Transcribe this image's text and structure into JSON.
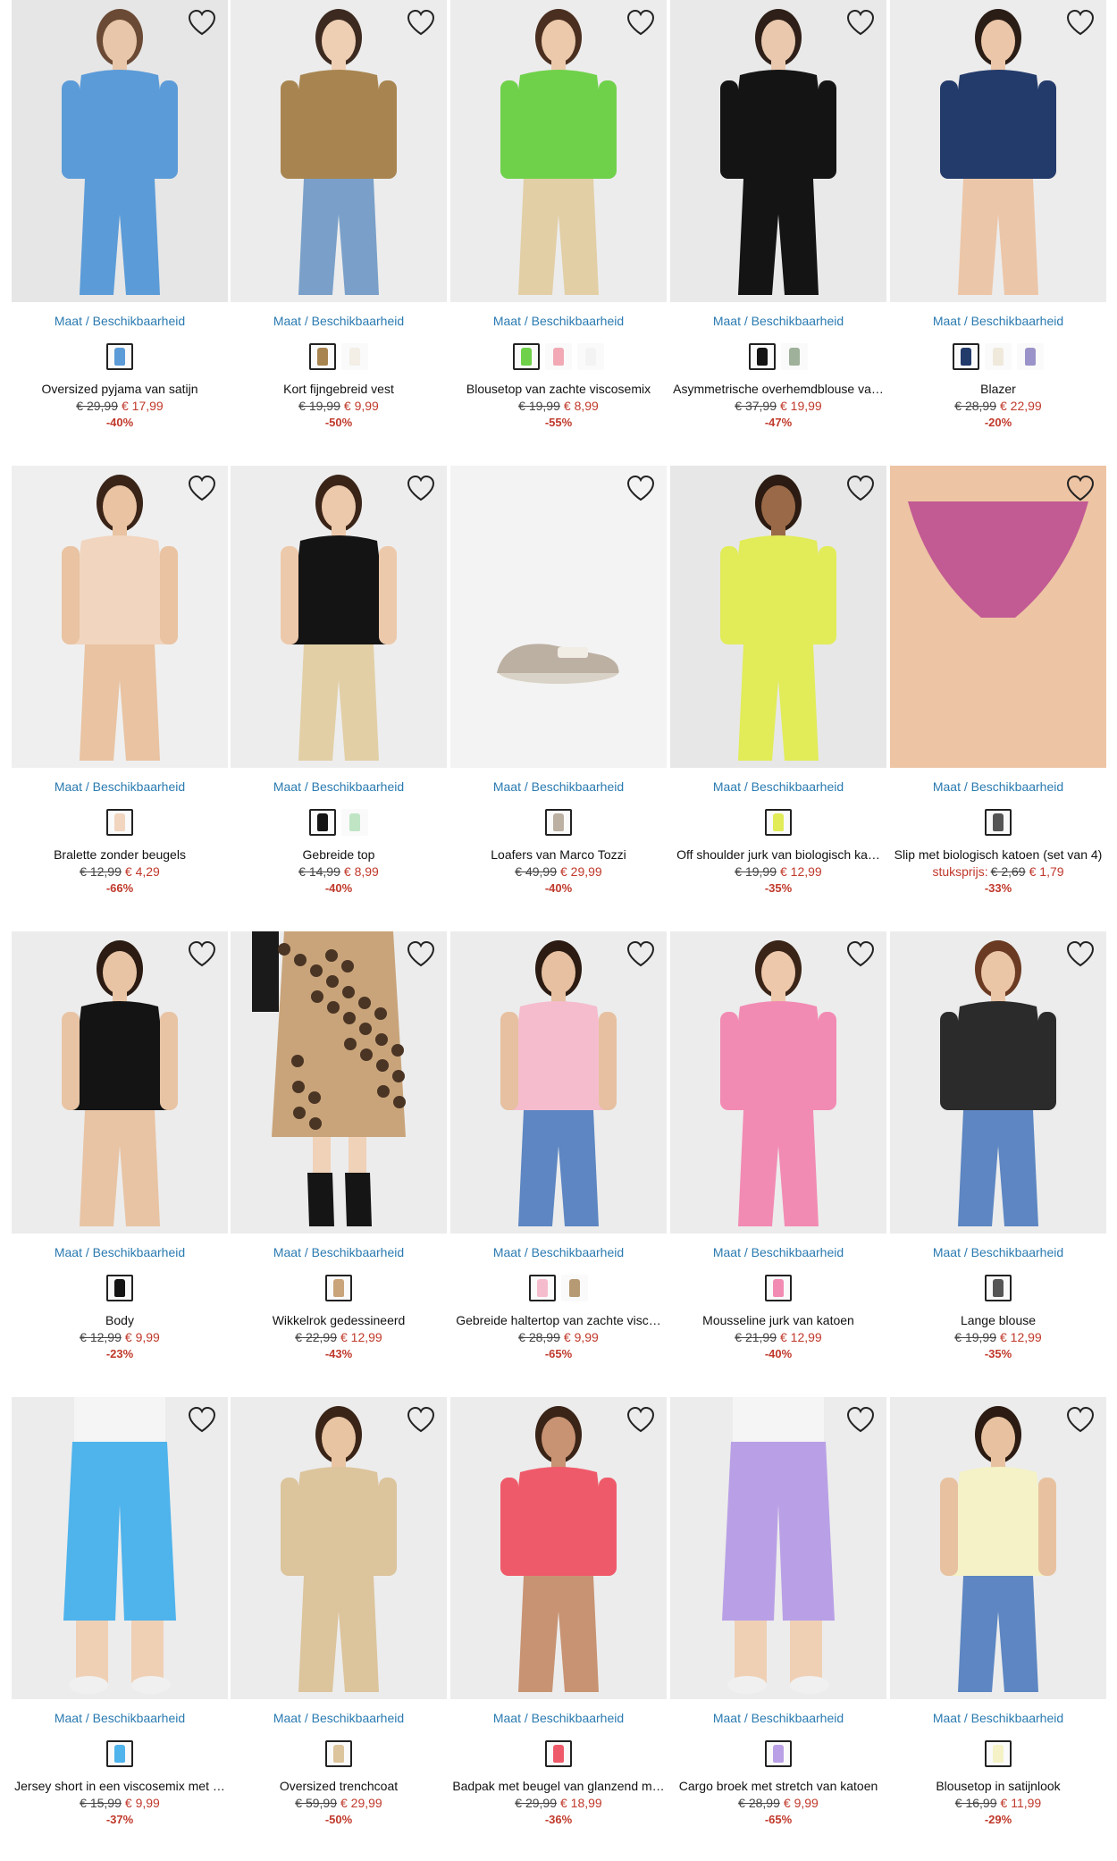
{
  "labels": {
    "maat": "Maat / Beschikbaarheid"
  },
  "products": [
    {
      "name": "Oversized pyjama van satijn",
      "old": "€ 29,99",
      "new": "€ 17,99",
      "disc": "-40%",
      "bg": "#e6e6e6",
      "garment": "#5b9bd8",
      "skin": "#e8c6a9",
      "hair": "#6b4a35",
      "swatches": [
        "#5b9bd8"
      ]
    },
    {
      "name": "Kort fijngebreid vest",
      "old": "€ 19,99",
      "new": "€ 9,99",
      "disc": "-50%",
      "bg": "#ececec",
      "garment": "#a88550",
      "skin": "#efcfb4",
      "hair": "#3c2a20",
      "swatches": [
        "#a88550",
        "#f3eee6"
      ]
    },
    {
      "name": "Blousetop van zachte viscosemix",
      "old": "€ 19,99",
      "new": "€ 8,99",
      "disc": "-55%",
      "bg": "#ececec",
      "garment": "#6fd14a",
      "skin": "#ecc9ab",
      "hair": "#4a2f20",
      "swatches": [
        "#6fd14a",
        "#f2a9b5",
        "#f3f3f3"
      ]
    },
    {
      "name": "Asymmetrische overhemdblouse va…",
      "old": "€ 37,99",
      "new": "€ 19,99",
      "disc": "-47%",
      "bg": "#e9e9e9",
      "garment": "#141414",
      "skin": "#eac8ad",
      "hair": "#2e2018",
      "swatches": [
        "#141414",
        "#9fb19a"
      ]
    },
    {
      "name": "Blazer",
      "old": "€ 28,99",
      "new": "€ 22,99",
      "disc": "-20%",
      "bg": "#ececec",
      "garment": "#233b6b",
      "skin": "#ecc6a8",
      "hair": "#2a1d16",
      "swatches": [
        "#233b6b",
        "#efe9dc",
        "#9a93c9"
      ]
    },
    {
      "name": "Bralette zonder beugels",
      "old": "€ 12,99",
      "new": "€ 4,29",
      "disc": "-66%",
      "bg": "#efefef",
      "garment": "#f1d5bf",
      "skin": "#e9c3a2",
      "hair": "#3a2418",
      "swatches": [
        "#f1d5bf"
      ]
    },
    {
      "name": "Gebreide top",
      "old": "€ 14,99",
      "new": "€ 8,99",
      "disc": "-40%",
      "bg": "#ededed",
      "garment": "#141414",
      "skin": "#edc9ab",
      "hair": "#3a2418",
      "swatches": [
        "#141414",
        "#bfe5c4"
      ]
    },
    {
      "name": "Loafers van Marco Tozzi",
      "old": "€ 49,99",
      "new": "€ 29,99",
      "disc": "-40%",
      "bg": "#f3f3f3",
      "garment": "#bcb0a2",
      "skin": "#f3f3f3",
      "hair": "#f3f3f3",
      "swatches": [
        "#bcb0a2"
      ]
    },
    {
      "name": "Off shoulder jurk van biologisch ka…",
      "old": "€ 19,99",
      "new": "€ 12,99",
      "disc": "-35%",
      "bg": "#e7e7e7",
      "garment": "#e1ec58",
      "skin": "#9a6a48",
      "hair": "#2b1b12",
      "swatches": [
        "#e1ec58"
      ]
    },
    {
      "name": "Slip met biologisch katoen (set van 4)",
      "unit": "stuksprijs:",
      "old": "€ 2,69",
      "new": "€ 1,79",
      "disc": "-33%",
      "bg": "#ececec",
      "garment": "#c25a93",
      "skin": "#edc4a4",
      "hair": "#ececec",
      "swatches": [
        "#555555"
      ]
    },
    {
      "name": "Body",
      "old": "€ 12,99",
      "new": "€ 9,99",
      "disc": "-23%",
      "bg": "#ececec",
      "garment": "#141414",
      "skin": "#e8c4a4",
      "hair": "#2b1b12",
      "swatches": [
        "#141414"
      ]
    },
    {
      "name": "Wikkelrok gedessineerd",
      "old": "€ 22,99",
      "new": "€ 12,99",
      "disc": "-43%",
      "bg": "#ececec",
      "garment": "#c9a47a",
      "skin": "#f0d2b8",
      "hair": "#ececec",
      "swatches": [
        "#c9a47a"
      ]
    },
    {
      "name": "Gebreide haltertop van zachte visc…",
      "old": "€ 28,99",
      "new": "€ 9,99",
      "disc": "-65%",
      "bg": "#ececec",
      "garment": "#f5bccd",
      "skin": "#e6c0a0",
      "hair": "#2b1b12",
      "swatches": [
        "#f5bccd",
        "#b59a73"
      ]
    },
    {
      "name": "Mousseline jurk van katoen",
      "old": "€ 21,99",
      "new": "€ 12,99",
      "disc": "-40%",
      "bg": "#ececec",
      "garment": "#f28bb3",
      "skin": "#eec8aa",
      "hair": "#3a2418",
      "swatches": [
        "#f28bb3"
      ]
    },
    {
      "name": "Lange blouse",
      "old": "€ 19,99",
      "new": "€ 12,99",
      "disc": "-35%",
      "bg": "#ececec",
      "garment": "#2b2b2b",
      "skin": "#eac5a6",
      "hair": "#6a3a22",
      "swatches": [
        "#555555"
      ]
    },
    {
      "name": "Jersey short in een viscosemix met …",
      "old": "€ 15,99",
      "new": "€ 9,99",
      "disc": "-37%",
      "bg": "#ececec",
      "garment": "#4fb3ec",
      "skin": "#efd0b5",
      "hair": "#ececec",
      "swatches": [
        "#4fb3ec"
      ]
    },
    {
      "name": "Oversized trenchcoat",
      "old": "€ 59,99",
      "new": "€ 29,99",
      "disc": "-50%",
      "bg": "#ececec",
      "garment": "#dcc49c",
      "skin": "#e9c4a3",
      "hair": "#3a2418",
      "swatches": [
        "#dcc49c"
      ]
    },
    {
      "name": "Badpak met beugel van glanzend m…",
      "old": "€ 29,99",
      "new": "€ 18,99",
      "disc": "-36%",
      "bg": "#ececec",
      "garment": "#ef5a6a",
      "skin": "#c89373",
      "hair": "#3a2418",
      "swatches": [
        "#ef5a6a"
      ]
    },
    {
      "name": "Cargo broek met stretch van katoen",
      "old": "€ 28,99",
      "new": "€ 9,99",
      "disc": "-65%",
      "bg": "#ececec",
      "garment": "#b9a0e6",
      "skin": "#efd0b5",
      "hair": "#ececec",
      "swatches": [
        "#b9a0e6"
      ]
    },
    {
      "name": "Blousetop in satijnlook",
      "old": "€ 16,99",
      "new": "€ 11,99",
      "disc": "-29%",
      "bg": "#ececec",
      "garment": "#f4f2c6",
      "skin": "#e8c2a0",
      "hair": "#2b1b12",
      "swatches": [
        "#f4f2c6"
      ]
    }
  ]
}
